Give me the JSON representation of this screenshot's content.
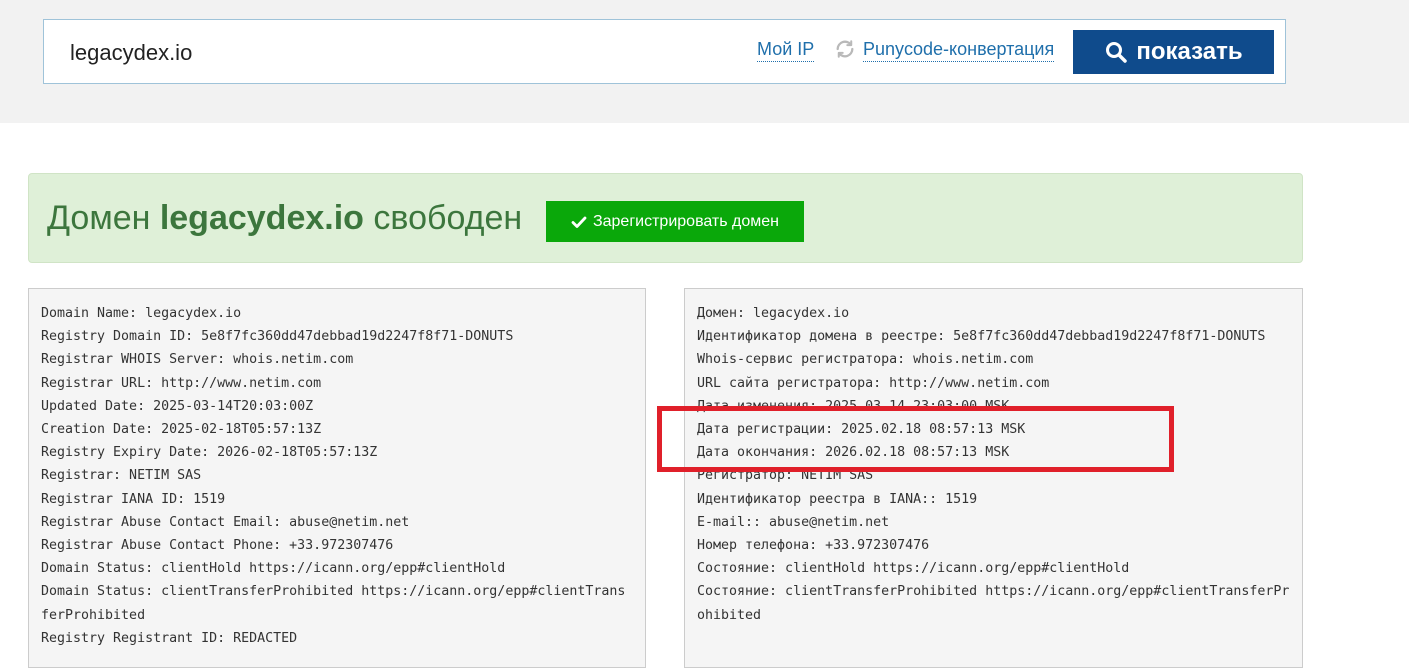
{
  "search": {
    "value": "legacydex.io",
    "my_ip_label": "Мой IP",
    "punycode_label": "Punycode-конвертация",
    "show_label": "показать"
  },
  "alert": {
    "prefix": "Домен ",
    "domain": "legacydex.io",
    "suffix": " свободен",
    "register_label": "Зарегистрировать домен"
  },
  "whois_raw": [
    "Domain Name: legacydex.io",
    "Registry Domain ID: 5e8f7fc360dd47debbad19d2247f8f71-DONUTS",
    "Registrar WHOIS Server: whois.netim.com",
    "Registrar URL: http://www.netim.com",
    "Updated Date: 2025-03-14T20:03:00Z",
    "Creation Date: 2025-02-18T05:57:13Z",
    "Registry Expiry Date: 2026-02-18T05:57:13Z",
    "Registrar: NETIM SAS",
    "Registrar IANA ID: 1519",
    "Registrar Abuse Contact Email: abuse@netim.net",
    "Registrar Abuse Contact Phone: +33.972307476",
    "Domain Status: clientHold https://icann.org/epp#clientHold",
    "Domain Status: clientTransferProhibited https://icann.org/epp#clientTransferProhibited",
    "Registry Registrant ID: REDACTED"
  ],
  "whois_translated": [
    "Домен: legacydex.io",
    "Идентификатор домена в реестре: 5e8f7fc360dd47debbad19d2247f8f71-DONUTS",
    "Whois-сервис регистратора: whois.netim.com",
    "URL сайта регистратора: http://www.netim.com",
    "Дата изменения: 2025.03.14 23:03:00 MSK",
    "Дата регистрации: 2025.02.18 08:57:13 MSK",
    "Дата окончания: 2026.02.18 08:57:13 MSK",
    "Регистратор: NETIM SAS",
    "Идентификатор реестра в IANA:: 1519",
    "E-mail:: abuse@netim.net",
    "Номер телефона: +33.972307476",
    "Состояние: clientHold https://icann.org/epp#clientHold",
    "Состояние: clientTransferProhibited https://icann.org/epp#clientTransferProhibited"
  ],
  "colors": {
    "accent": "#0f4b8c",
    "link": "#1f6fab",
    "success_bg": "#dff0d8",
    "success_text": "#3c763d",
    "register_button": "#0aa80a",
    "annotation": "#e0202a"
  }
}
